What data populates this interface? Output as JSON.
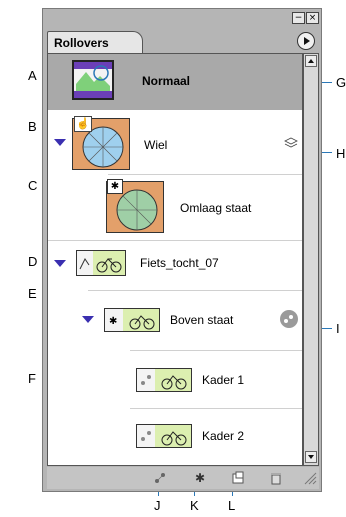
{
  "panel": {
    "tab_label": "Rollovers",
    "minimize_label": "−",
    "close_label": "×",
    "menu_icon": "panel-menu-icon"
  },
  "rows": {
    "normal": {
      "label": "Normaal"
    },
    "wiel": {
      "label": "Wiel"
    },
    "omlaag": {
      "label": "Omlaag staat"
    },
    "fiets": {
      "label": "Fiets_tocht_07"
    },
    "boven": {
      "label": "Boven staat"
    },
    "kader1": {
      "label": "Kader 1"
    },
    "kader2": {
      "label": "Kader 2"
    }
  },
  "callouts": {
    "a": "A",
    "b": "B",
    "c": "C",
    "d": "D",
    "e": "E",
    "f": "F",
    "g": "G",
    "h": "H",
    "i": "I",
    "j": "J",
    "k": "K",
    "l": "L"
  },
  "colors": {
    "accent_line": "#2a78b8",
    "selection": "#a9a9a9",
    "triangle": "#3a2fb0"
  }
}
